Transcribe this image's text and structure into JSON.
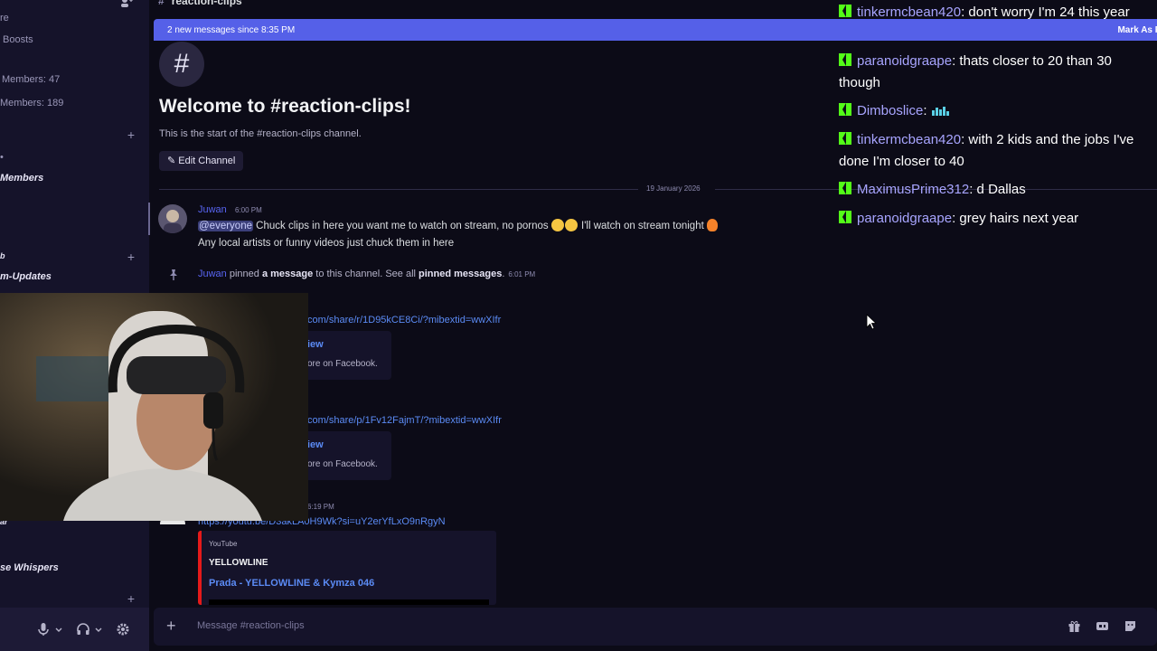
{
  "sidebar": {
    "rows": {
      "partial": "re",
      "boosts": "Boosts",
      "members_47": "Members: 47",
      "members_189": "Members: 189",
      "members": "Members",
      "b": "b",
      "updates": "m-Updates",
      "ar": "ar",
      "whispers": "se Whispers"
    },
    "plus": "+"
  },
  "channel": {
    "name": "reaction-clips",
    "new_messages": "2 new messages since 8:35 PM",
    "mark_as_read": "Mark As R",
    "welcome_title": "Welcome to #reaction-clips!",
    "welcome_subtitle": "This is the start of the #reaction-clips channel.",
    "edit_button": "Edit Channel",
    "date_divider": "19 January 2026"
  },
  "messages": {
    "author": "Juwan",
    "time": "6:00 PM",
    "mention": "@everyone",
    "text_a": " Chuck clips in here you want me to watch on stream, no pornos ",
    "text_b": " I'll watch on stream tonight ",
    "line2": "Any local artists or funny videos just chuck them in here",
    "pin": {
      "user": "Juwan",
      "pinned": " pinned ",
      "a_message": "a message",
      "mid": " to this channel. See all ",
      "pinned_messages": "pinned messages",
      "dot": ".",
      "time": "6:01 PM"
    },
    "link1": "com/share/r/1D95kCE8Ci/?mibextid=wwXIfr",
    "link2": "com/share/p/1Fv12FajmT/?mibextid=wwXIfr",
    "embed_view": "iew",
    "embed_more": "ore on Facebook.",
    "time3": "6:19 PM",
    "link3": "https://youtu.be/D3akLA0H9Wk?si=uY2erYfLxO9nRgyN",
    "youtube": {
      "provider": "YouTube",
      "author": "YELLOWLINE",
      "title": "Prada - YELLOWLINE & Kymza 046"
    }
  },
  "composer": {
    "placeholder": "Message #reaction-clips"
  },
  "stream_chat": [
    {
      "name": "tinkermcbean420",
      "text": " don't worry I'm 24 this year"
    },
    {
      "name": "paranoidgraape",
      "text": " thats closer to 20 than 30 though"
    },
    {
      "name": "Dimboslice",
      "text": " "
    },
    {
      "name": "tinkermcbean420",
      "text": " with 2 kids and the jobs I've done I'm closer to 40"
    },
    {
      "name": "MaximusPrime312",
      "text": " d Dallas"
    },
    {
      "name": "paranoidgraape",
      "text": " grey hairs next year"
    }
  ],
  "colors": {
    "accent": "#5865f2",
    "banner": "#5560e8",
    "kick_green": "#53fc18",
    "chat_name": "#a8a5ff",
    "youtube_red": "#e51a1a"
  }
}
